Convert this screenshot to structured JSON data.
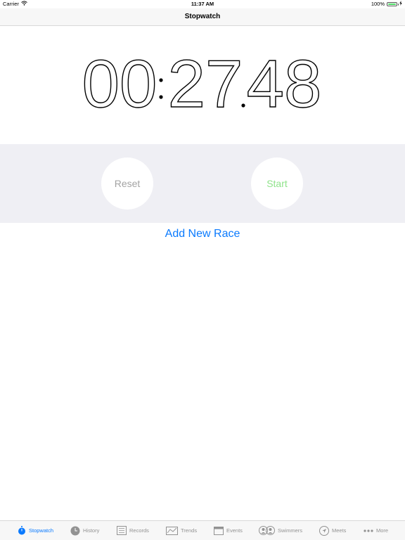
{
  "status_bar": {
    "carrier": "Carrier",
    "time": "11:37 AM",
    "battery": "100%"
  },
  "nav": {
    "title": "Stopwatch"
  },
  "timer": {
    "minutes": "00",
    "seconds": "27",
    "hundredths": "48"
  },
  "controls": {
    "reset_label": "Reset",
    "start_label": "Start"
  },
  "add_race_label": "Add New Race",
  "tabs": [
    {
      "label": "Stopwatch",
      "icon": "stopwatch-icon",
      "active": true
    },
    {
      "label": "History",
      "icon": "clock-icon",
      "active": false
    },
    {
      "label": "Records",
      "icon": "list-icon",
      "active": false
    },
    {
      "label": "Trends",
      "icon": "chart-icon",
      "active": false
    },
    {
      "label": "Events",
      "icon": "calendar-icon",
      "active": false
    },
    {
      "label": "Swimmers",
      "icon": "people-icon",
      "active": false
    },
    {
      "label": "Meets",
      "icon": "location-arrow-icon",
      "active": false
    },
    {
      "label": "More",
      "icon": "more-icon",
      "active": false
    }
  ],
  "colors": {
    "accent": "#0a7afe",
    "start_green": "#8fe38a",
    "reset_gray": "#a3a3a3",
    "panel_bg": "#efeff4",
    "battery_green": "#4cd964"
  }
}
